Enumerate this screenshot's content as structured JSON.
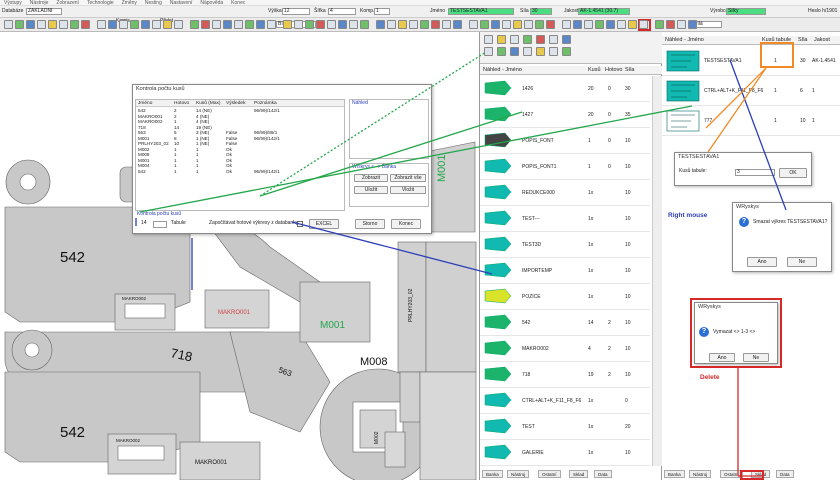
{
  "menu": [
    "Výstupy",
    "Nástroje",
    "Zobrazení",
    "Technologie",
    "Změny",
    "Nesting",
    "Nastavení",
    "Nápověda",
    "Konec"
  ],
  "toolbar1": {
    "databaze_label": "Databáze",
    "databaze_value": "ZAKLADNI",
    "vyska_label": "Výška",
    "vyska_value": "12",
    "sirka_label": "Šířka",
    "sirka_value": "4",
    "komp_label": "Komp.",
    "komp_value": "1",
    "jmeno_label": "Jméno",
    "jmeno_value": "TESTSESTAVA1",
    "sila_label": "Síla",
    "sila_value": "30",
    "jakost_label": "Jakost",
    "jakost_value": "AK-1.4541 (30.7)",
    "vyrobce_label": "Výrobce",
    "vyrobce_value": "Silky",
    "hesla_label": "Heslo h/1901"
  },
  "toolbar2": {
    "komis_label": "Komis",
    "pridat_label": "Přidat",
    "barva_value": "Bílá",
    "barva2_value": "Bílá"
  },
  "canvas": {
    "parts": [
      "542",
      "718",
      "542",
      "M008",
      "563",
      "M001",
      "M001",
      "MAKRO001",
      "MAKRO001",
      "MAKRO002",
      "MAKRO002",
      "PRLHY203_02",
      "M002"
    ]
  },
  "kontrola": {
    "title": "Kontrola počtu kusů",
    "headers": [
      "Jméno",
      "Hotovo",
      "Kusů (Max)",
      "Výsledek",
      "Poznámka"
    ],
    "rows": [
      [
        "542",
        "2",
        "14 (NE)",
        "",
        "96/99)/142/1"
      ],
      [
        "MAKRO001",
        "2",
        "4 (NE)",
        "",
        ""
      ],
      [
        "MAKRO002",
        "1",
        "4 (NE)",
        "",
        ""
      ],
      [
        "718",
        "14",
        "19 (NE)",
        "",
        ""
      ],
      [
        "563",
        "5",
        "3 (NE)",
        "False",
        "96/99)/89/1"
      ],
      [
        "M001",
        "8",
        "1 (NE)",
        "False",
        "96/99)/142/1"
      ],
      [
        "PRLHY203_02",
        "10",
        "1 (NE)",
        "False",
        ""
      ],
      [
        "M002",
        "1",
        "1",
        "Ok",
        ""
      ],
      [
        "M008",
        "1",
        "1",
        "Ok",
        ""
      ],
      [
        "M001",
        "1",
        "1",
        "Ok",
        ""
      ],
      [
        "M004",
        "1",
        "1",
        "Ok",
        ""
      ],
      [
        "542",
        "1",
        "1",
        "Ok",
        "96/99)/142/1"
      ]
    ],
    "nahled_label": "Náhled",
    "wrskrys_label": "Wrskrys <--> Banka",
    "pocet_label": "Kontrola počtu kusů",
    "count_value": "14",
    "tabule_label": "Tabule",
    "zapocitavat_label": "Započítávat hotové výkresy z databanky",
    "excel_label": "EXCEL",
    "storno_label": "Storno",
    "konec_label": "Konec",
    "btn_labels": [
      "Zobrazit",
      "Zobrazit vše",
      "Uložit",
      "Vložit"
    ]
  },
  "mid": {
    "headers": [
      "Náhled - Jméno",
      "Kusů",
      "Hotovo",
      "Síla"
    ],
    "rows": [
      {
        "name": "1426",
        "kusu": "20",
        "hotovo": "0",
        "sila": "30"
      },
      {
        "name": "1427",
        "kusu": "20",
        "hotovo": "0",
        "sila": "35"
      },
      {
        "name": "POPIS_FONT",
        "kusu": "1",
        "hotovo": "0",
        "sila": "10"
      },
      {
        "name": "POPIS_FONT1",
        "kusu": "1",
        "hotovo": "0",
        "sila": "10"
      },
      {
        "name": "REDUKCE000",
        "kusu": "1x",
        "hotovo": "",
        "sila": "10"
      },
      {
        "name": "TEST---",
        "kusu": "1x",
        "hotovo": "",
        "sila": "10"
      },
      {
        "name": "TEST3D",
        "kusu": "1x",
        "hotovo": "",
        "sila": "10"
      },
      {
        "name": "IMPORTEMP",
        "kusu": "1x",
        "hotovo": "",
        "sila": "10"
      },
      {
        "name": "POZICE",
        "kusu": "1x",
        "hotovo": "",
        "sila": "10"
      },
      {
        "name": "542",
        "kusu": "14",
        "hotovo": "2",
        "sila": "10"
      },
      {
        "name": "MAKRO002",
        "kusu": "4",
        "hotovo": "2",
        "sila": "10"
      },
      {
        "name": "718",
        "kusu": "19",
        "hotovo": "2",
        "sila": "10"
      },
      {
        "name": "CTRL+ALT+K_F11_F8_F6",
        "kusu": "1x",
        "hotovo": "",
        "sila": "0"
      },
      {
        "name": "TEST",
        "kusu": "1x",
        "hotovo": "",
        "sila": "20"
      },
      {
        "name": "GALERIE",
        "kusu": "1x",
        "hotovo": "",
        "sila": "10"
      }
    ],
    "tabs": [
      "Banka",
      "Nástroj",
      "Ostatní",
      "Sklad",
      "Data"
    ]
  },
  "right": {
    "headers": [
      "Náhled - Jméno",
      "Kusů tabule",
      "Síla",
      "Jakost"
    ],
    "rows": [
      {
        "name": "TESTSESTAVA1",
        "kusu": "1",
        "sila": "30",
        "jakost": "AK-1.4541"
      },
      {
        "name": "CTRL+ALT+K_F11_F8_F6",
        "kusu": "1",
        "sila": "6",
        "jakost": "1"
      },
      {
        "name": "777",
        "kusu": "1",
        "sila": "10",
        "jakost": "1"
      }
    ],
    "tabs": [
      "Banka",
      "Nástroj",
      "Ostatní",
      "Sklad",
      "Data"
    ]
  },
  "dialog_tabule": {
    "title": "TESTSESTAVA1",
    "label": "Kusů tabule:",
    "value": "3",
    "ok": "OK"
  },
  "dialog_smazat": {
    "title": "WRyskys",
    "message": "Smazat výkres TESTSESTAVA1?",
    "yes": "Ano",
    "no": "Ne"
  },
  "dialog_delete": {
    "title": "WRyskys",
    "message": "Vymazat <> 1-3 <>",
    "yes": "Ano",
    "no": "Ne"
  },
  "annotations": {
    "right_mouse": "Right mouse",
    "delete": "Delete"
  },
  "colors": {
    "accent_green": "#22a64a",
    "accent_blue": "#2c3fb8",
    "accent_orange": "#f08a24",
    "accent_red": "#d62828",
    "part_gray": "#bdbdbd",
    "thumb_teal": "#12b9b0"
  }
}
